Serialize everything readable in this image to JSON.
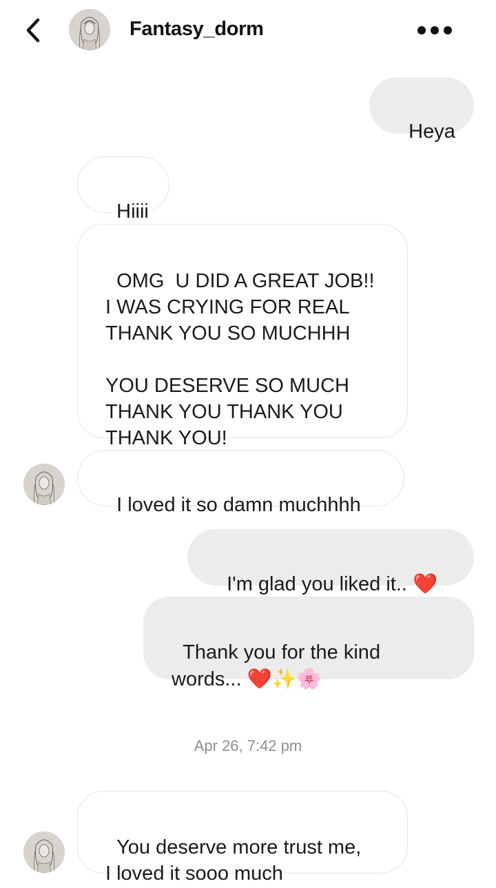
{
  "header": {
    "title": "Fantasy_dorm",
    "back_icon": "chevron-left-icon",
    "more_icon": "more-horizontal-icon"
  },
  "messages": [
    {
      "side": "out",
      "text": "Heya"
    },
    {
      "side": "in",
      "text": "Hiiii"
    },
    {
      "side": "in",
      "text": "OMG  U DID A GREAT JOB!!\nI WAS CRYING FOR REAL\nTHANK YOU SO MUCHHH\n\nYOU DESERVE SO MUCH\nTHANK YOU THANK YOU\nTHANK YOU!"
    },
    {
      "side": "in",
      "text": "I loved it so damn muchhhh"
    },
    {
      "side": "out",
      "text": "I'm glad you liked it.. "
    },
    {
      "side": "out",
      "text": "Thank you for the kind\nwords... "
    },
    {
      "side": "in",
      "text": "You deserve more trust me,\nI loved it sooo much"
    }
  ],
  "emojis": {
    "heart": "❤️",
    "sparkles": "✨",
    "blossom": "🌸"
  },
  "timestamp": "Apr 26, 7:42 pm",
  "colors": {
    "outgoing_bubble": "#ececec",
    "incoming_border": "#e6e6e6",
    "timestamp_text": "#8e8e8e",
    "heart": "#e8202a"
  }
}
